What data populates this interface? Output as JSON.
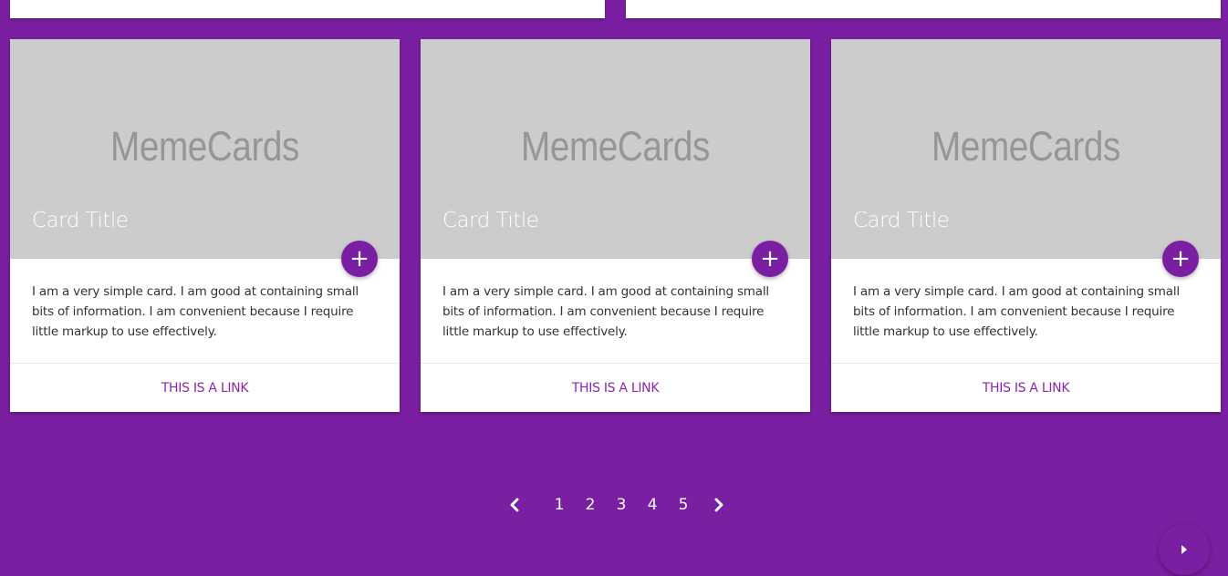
{
  "colors": {
    "background": "#7b1fa2",
    "accent": "#7b1fa2",
    "link": "#8e24aa",
    "image_placeholder": "#cccccc"
  },
  "cards": [
    {
      "image_text": "MemeCards",
      "title": "Card Title",
      "fab_icon": "plus-icon",
      "content": "I am a very simple card. I am good at containing small bits of information. I am convenient because I require little markup to use effectively.",
      "link": "THIS IS A LINK"
    },
    {
      "image_text": "MemeCards",
      "title": "Card Title",
      "fab_icon": "plus-icon",
      "content": "I am a very simple card. I am good at containing small bits of information. I am convenient because I require little markup to use effectively.",
      "link": "THIS IS A LINK"
    },
    {
      "image_text": "MemeCards",
      "title": "Card Title",
      "fab_icon": "plus-icon",
      "content": "I am a very simple card. I am good at containing small bits of information. I am convenient because I require little markup to use effectively.",
      "link": "THIS IS A LINK"
    }
  ],
  "pagination": {
    "prev_icon": "chevron-left-icon",
    "next_icon": "chevron-right-icon",
    "pages": [
      "1",
      "2",
      "3",
      "4",
      "5"
    ]
  },
  "corner_button": {
    "icon": "play-arrow-icon"
  }
}
